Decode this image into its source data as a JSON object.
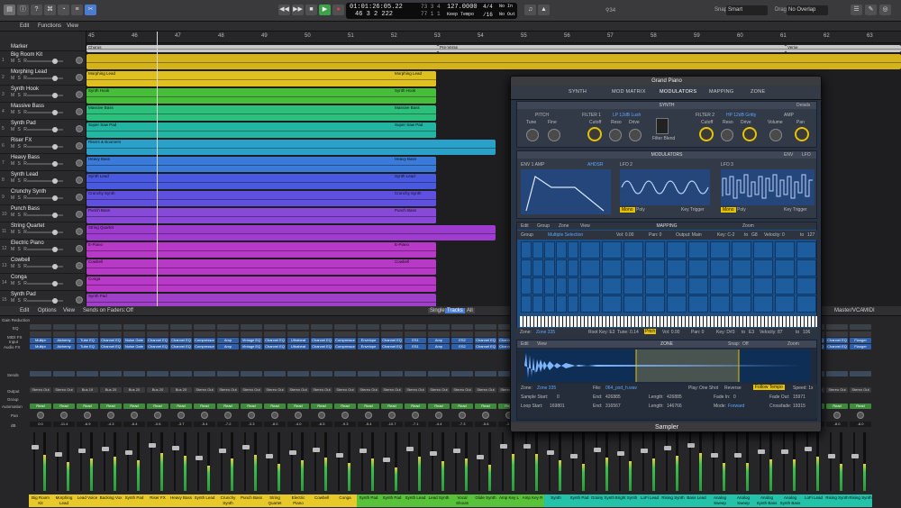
{
  "transport": {
    "position": "01:01:26:05.22",
    "bars": "46  3  2  222",
    "cpu_top": "73  3  4",
    "cpu_bottom": "77  1  1",
    "tempo": "127.0000",
    "tempo_mode": "Keep Tempo",
    "sig": "4/4",
    "div": "/16",
    "in": "No In",
    "out": "No Out",
    "snap_label": "Snap:",
    "snap": "Smart",
    "drag_label": "Drag:",
    "drag": "No Overlap",
    "badge": "⚲34"
  },
  "menubar": {
    "edit": "Edit",
    "functions": "Functions",
    "view": "View"
  },
  "ruler": [
    "45",
    "46",
    "47",
    "48",
    "49",
    "50",
    "51",
    "52",
    "53",
    "54",
    "55",
    "56",
    "57",
    "58",
    "59",
    "60",
    "61",
    "62",
    "63"
  ],
  "marker": {
    "label": "Marker",
    "chorus": "Chorus",
    "pre_verse": "Pre-Verse",
    "verse": "Verse"
  },
  "tracks": [
    {
      "num": "1",
      "name": "Big Room Kit"
    },
    {
      "num": "2",
      "name": "Morphing Lead"
    },
    {
      "num": "3",
      "name": "Synth Hook"
    },
    {
      "num": "4",
      "name": "Massive Bass"
    },
    {
      "num": "5",
      "name": "Synth Pad"
    },
    {
      "num": "6",
      "name": "Riser FX"
    },
    {
      "num": "7",
      "name": "Heavy Bass"
    },
    {
      "num": "8",
      "name": "Synth Lead"
    },
    {
      "num": "9",
      "name": "Crunchy Synth"
    },
    {
      "num": "10",
      "name": "Punch Bass"
    },
    {
      "num": "11",
      "name": "String Quartet"
    },
    {
      "num": "12",
      "name": "Electric Piano"
    },
    {
      "num": "13",
      "name": "Cowbell"
    },
    {
      "num": "14",
      "name": "Conga"
    },
    {
      "num": "15",
      "name": "Synth Pad"
    }
  ],
  "track_ms": "M  S  R",
  "regions": {
    "chorus": "Chorus",
    "pre_verse": "Pre-Verse",
    "verse": "Verse",
    "morph": "Morphing Lead",
    "hook": "Synth Hook",
    "massive": "Massive Bass",
    "sawpad": "Super Saw Pad",
    "risers": "Risers & Boomers",
    "heavy": "Heavy Bass",
    "lead": "Synth Lead",
    "crunchy": "Crunchy Synth",
    "punch": "Punch Bass",
    "strings": "String Quartet",
    "epiano": "E-Piano",
    "cowbell": "Cowbell",
    "conga": "Conga",
    "pad": "Synth Pad"
  },
  "mixer": {
    "edit": "Edit",
    "options": "Options",
    "view": "View",
    "sends": "Sends on Faders:",
    "sends_val": "Off",
    "single": "Single",
    "tracks": "Tracks",
    "all": "All",
    "mastervca": "Master/VCA",
    "midi": "MIDI",
    "gain": "Gain Reduction",
    "eq": "EQ",
    "midifx": "MIDI FX",
    "input": "Input",
    "audiofx": "Audio FX",
    "sends_lbl": "Sends",
    "output": "Output",
    "group": "Group",
    "automation": "Automation",
    "pan": "Pan",
    "db": "dB"
  },
  "channels": [
    {
      "name": "Big Room Kit",
      "color": "#e8c92a",
      "fx": "Multipr",
      "out": "Stereo Out",
      "read": "Read",
      "db": "0.0"
    },
    {
      "name": "Morphing Lead",
      "color": "#e8c92a",
      "fx": "Alchemy",
      "out": "Stereo Out",
      "read": "Read",
      "db": "-11.4"
    },
    {
      "name": "Lead Voice",
      "color": "#e8c92a",
      "fx": "Tube EQ",
      "out": "Bus 19",
      "read": "Read",
      "db": "-6.9"
    },
    {
      "name": "Backing Vox",
      "color": "#e8c92a",
      "fx": "Channel EQ",
      "out": "Bus 20",
      "read": "Read",
      "db": "-4.3"
    },
    {
      "name": "Synth Pad",
      "color": "#e8c92a",
      "fx": "Noise Gate",
      "out": "Bus 20",
      "read": "Read",
      "db": "-6.4"
    },
    {
      "name": "Riser FX",
      "color": "#e8c92a",
      "fx": "Channel EQ",
      "out": "Bus 20",
      "read": "Read",
      "db": "-0.6"
    },
    {
      "name": "Heavy Bass",
      "color": "#e8c92a",
      "fx": "Channel EQ",
      "out": "Bus 20",
      "read": "Read",
      "db": "-3.7"
    },
    {
      "name": "Synth Lead",
      "color": "#e8c92a",
      "fx": "Compressor",
      "out": "Stereo Out",
      "read": "Read",
      "db": "-5.4"
    },
    {
      "name": "Crunchy Synth",
      "color": "#e8c92a",
      "fx": "Amp",
      "out": "Stereo Out",
      "read": "Read",
      "db": "-7.2"
    },
    {
      "name": "Punch Bass",
      "color": "#e8c92a",
      "fx": "Vintage EQ",
      "out": "Stereo Out",
      "read": "Read",
      "db": "-3.3"
    },
    {
      "name": "String Quartet",
      "color": "#e8c92a",
      "fx": "Channel EQ",
      "out": "Stereo Out",
      "read": "Read",
      "db": "-8.0"
    },
    {
      "name": "Electric Piano",
      "color": "#e8c92a",
      "fx": "Ultrabeat",
      "out": "Stereo Out",
      "read": "Read",
      "db": "-4.0"
    },
    {
      "name": "Cowbell",
      "color": "#e8c92a",
      "fx": "Channel EQ",
      "out": "Stereo Out",
      "read": "Read",
      "db": "-6.5"
    },
    {
      "name": "Conga",
      "color": "#e8c92a",
      "fx": "Compressor",
      "out": "Stereo Out",
      "read": "Read",
      "db": "-9.3"
    },
    {
      "name": "Synth Pad",
      "color": "#58c23a",
      "fx": "Envelope",
      "out": "Stereo Out",
      "read": "Read",
      "db": "-5.4"
    },
    {
      "name": "Synth Pad",
      "color": "#58c23a",
      "fx": "Channel EQ",
      "out": "Stereo Out",
      "read": "Read",
      "db": "-10.7"
    },
    {
      "name": "Synth Lead",
      "color": "#58c23a",
      "fx": "ES1",
      "out": "Stereo Out",
      "read": "Read",
      "db": "-7.1"
    },
    {
      "name": "Lead Synth",
      "color": "#58c23a",
      "fx": "Amp",
      "out": "Stereo Out",
      "read": "Read",
      "db": "-4.4"
    },
    {
      "name": "Vocal Shouts",
      "color": "#58c23a",
      "fx": "ES2",
      "out": "Stereo Out",
      "read": "Read",
      "db": "-7.3"
    },
    {
      "name": "Glide Synth",
      "color": "#58c23a",
      "fx": "Channel EQ",
      "out": "Stereo Out",
      "read": "Read",
      "db": "-5.6"
    },
    {
      "name": "Amp Key L",
      "color": "#58c23a",
      "fx": "Channel EQ",
      "out": "Stereo Out",
      "read": "Read",
      "db": "-3.8"
    },
    {
      "name": "Amp Key R",
      "color": "#58c23a",
      "fx": "Channel EQ",
      "out": "Stereo Out",
      "read": "Read",
      "db": "-3.8"
    },
    {
      "name": "Synth",
      "color": "#24c2a9",
      "fx": "Channel EQ",
      "out": "Stereo Out",
      "read": "Read",
      "db": "-6.0"
    },
    {
      "name": "Synth Pad",
      "color": "#24c2a9",
      "fx": "Channel EQ",
      "out": "Stereo Out",
      "read": "Read",
      "db": "-8.3"
    },
    {
      "name": "Grainy Synth",
      "color": "#24c2a9",
      "fx": "Channel EQ",
      "out": "Stereo Out",
      "read": "Read",
      "db": "-4.4"
    },
    {
      "name": "Bright Synth",
      "color": "#24c2a9",
      "fx": "Channel EQ",
      "out": "Stereo Out",
      "read": "Read",
      "db": "-6.2"
    },
    {
      "name": "LoFi Lead",
      "color": "#24c2a9",
      "fx": "Channel EQ",
      "out": "Stereo Out",
      "read": "Read",
      "db": "-7.1"
    },
    {
      "name": "Rising Synth",
      "color": "#24c2a9",
      "fx": "Channel EQ",
      "out": "Stereo Out",
      "read": "Read",
      "db": "-5.4"
    },
    {
      "name": "Bass Lead",
      "color": "#24c2a9",
      "fx": "Channel EQ",
      "out": "Stereo Out",
      "read": "Read",
      "db": "-3.1"
    },
    {
      "name": "Analog Sweep",
      "color": "#24c2a9",
      "fx": "Channel EQ",
      "out": "Stereo Out",
      "read": "Read",
      "db": "-6.7"
    },
    {
      "name": "Analog Sweep",
      "color": "#24c2a9",
      "fx": "Channel EQ",
      "out": "Stereo Out",
      "read": "Read",
      "db": "-6.7"
    },
    {
      "name": "Analog Synth Bass",
      "color": "#24c2a9",
      "fx": "Channel EQ",
      "out": "Stereo Out",
      "read": "Read",
      "db": "-4.8"
    },
    {
      "name": "Analog Synth Bass",
      "color": "#24c2a9",
      "fx": "Channel EQ",
      "out": "Stereo Out",
      "read": "Read",
      "db": "-4.8"
    },
    {
      "name": "LoFi Lead",
      "color": "#24c2a9",
      "fx": "Channel EQ",
      "out": "Stereo Out",
      "read": "Read",
      "db": "-5.2"
    },
    {
      "name": "Rising Synth",
      "color": "#24c2a9",
      "fx": "Channel EQ",
      "out": "Stereo Out",
      "read": "Read",
      "db": "-8.0"
    },
    {
      "name": "Rising Synth",
      "color": "#24c2a9",
      "fx": "Flanger",
      "out": "Stereo Out",
      "read": "Read",
      "db": "-8.0"
    }
  ],
  "sampler": {
    "title": "Grand Piano",
    "footer": "Sampler",
    "tabs": [
      "SYNTH",
      "MOD MATRIX",
      "MODULATORS",
      "MAPPING",
      "ZONE"
    ],
    "synth": "SYNTH",
    "details": "Details",
    "pitch": "PITCH",
    "tune": "Tune",
    "fine": "Fine",
    "filter1": "FILTER 1",
    "filter1_type": "LP 12dB Lush",
    "cutoff": "Cutoff",
    "reso": "Reso",
    "drive": "Drive",
    "filter_blend": "Filter Blend",
    "filter2": "FILTER 2",
    "filter2_type": "HP 12dB Gritty",
    "amp": "AMP",
    "volume": "Volume",
    "pan": "Pan",
    "modulators": "MODULATORS",
    "env_tag": "ENV",
    "lfo_tag": "LFO",
    "env1": "ENV 1 AMP",
    "adsr": "AHDSR",
    "lfo2": "LFO 2",
    "lfo3": "LFO 3",
    "mono": "Mono",
    "poly": "Poly",
    "key_trigger": "Key Trigger",
    "mapping": "MAPPING",
    "map_edit": "Edit",
    "map_group": "Group",
    "map_zone": "Zone",
    "map_view": "View",
    "zoom": "Zoom",
    "group": "Group",
    "multi": "Multiple Selection",
    "vol": "Vol: 0.00",
    "pan_v": "Pan: 0",
    "output": "Output: Main",
    "key": "Key: C-2",
    "to": "to",
    "g8": "G8",
    "vel": "Velocity: 0",
    "to2": "to",
    "vel_max": "127",
    "zone_label": "Zone:",
    "zone_val": "Zone 335",
    "root": "Root Key: E3",
    "tune_v": "Tune: 0.14",
    "pitch_btn": "Pitch",
    "vol2": "Vol: 0.00",
    "pan2": "Pan: 0",
    "key2": "Key: D#3",
    "to3": "to",
    "e3": "E3",
    "vel2": "Velocity: 87",
    "to4": "to",
    "vel_max2": "106",
    "zone": "ZONE",
    "snap": "Snap:",
    "snap_val": "Off",
    "zoom2": "Zoom",
    "zone2_label": "Zone:",
    "zone2_val": "Zone 335",
    "file": "File:",
    "file_val": "064_psd_h.wav",
    "play": "Play:",
    "one_shot": "One Shot",
    "reverse": "Reverse",
    "follow_tempo": "Follow Tempo",
    "speed": "Speed: 1x",
    "sample_start": "Sample Start:",
    "ss_val": "0",
    "end": "End:",
    "end_val": "426885",
    "length": "Length:",
    "len_val": "426885",
    "fade_in": "Fade In:",
    "fi_val": "0",
    "loop_start": "Loop Start:",
    "ls_val": "169801",
    "end2": "End:",
    "end2_val": "316567",
    "length2": "Length:",
    "len2_val": "146766",
    "mode": "Mode:",
    "mode_val": "Forward",
    "crossfade": "Crossfade:",
    "cf_val": "19315",
    "fade_out": "Fade Out:",
    "fo_val": "15971"
  }
}
